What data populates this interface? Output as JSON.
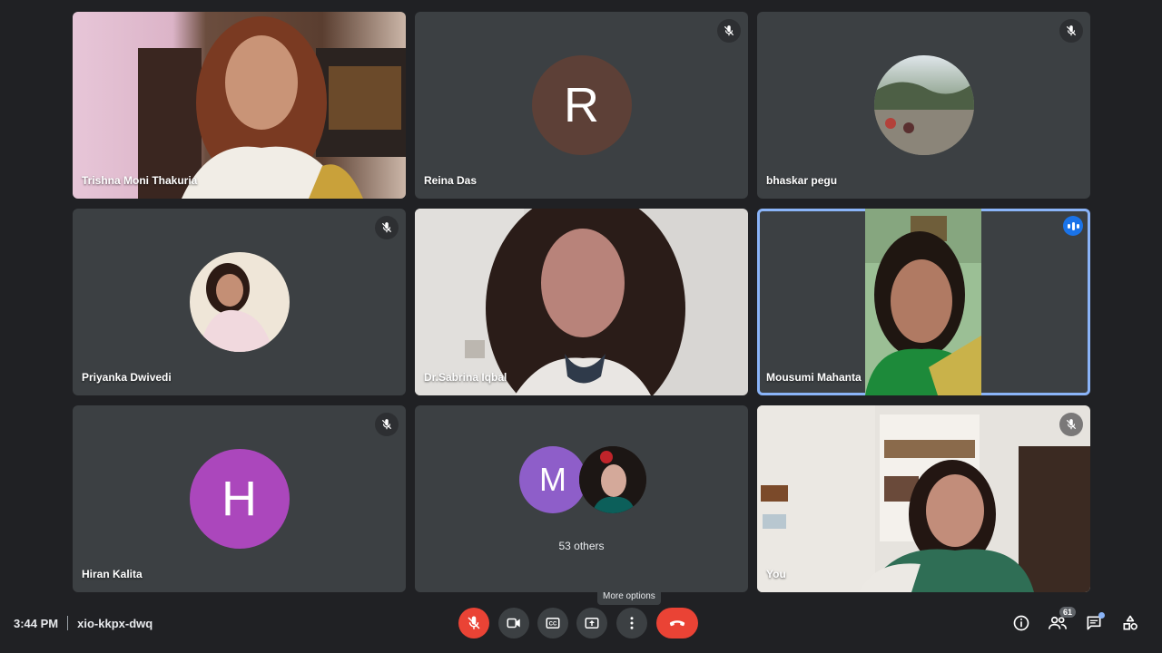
{
  "participants": [
    {
      "name": "Trishna Moni Thakuria"
    },
    {
      "name": "Reina Das",
      "initial": "R",
      "avatar_color": "#5d4037"
    },
    {
      "name": "bhaskar pegu"
    },
    {
      "name": "Priyanka Dwivedi"
    },
    {
      "name": "Dr.Sabrina Iqbal"
    },
    {
      "name": "Mousumi Mahanta"
    },
    {
      "name": "Hiran Kalita",
      "initial": "H",
      "avatar_color": "#ab47bc"
    },
    {
      "name": "You"
    }
  ],
  "others": {
    "initial": "M",
    "avatar_color": "#8e5ec9",
    "label": "53 others"
  },
  "tooltip": "More options",
  "meeting": {
    "time": "3:44 PM",
    "code": "xio-kkpx-dwq"
  },
  "people_count": "61",
  "colors": {
    "end_call": "#ea4335",
    "active_border": "#8ab4f8",
    "background": "#202124",
    "tile": "#3c4043"
  }
}
